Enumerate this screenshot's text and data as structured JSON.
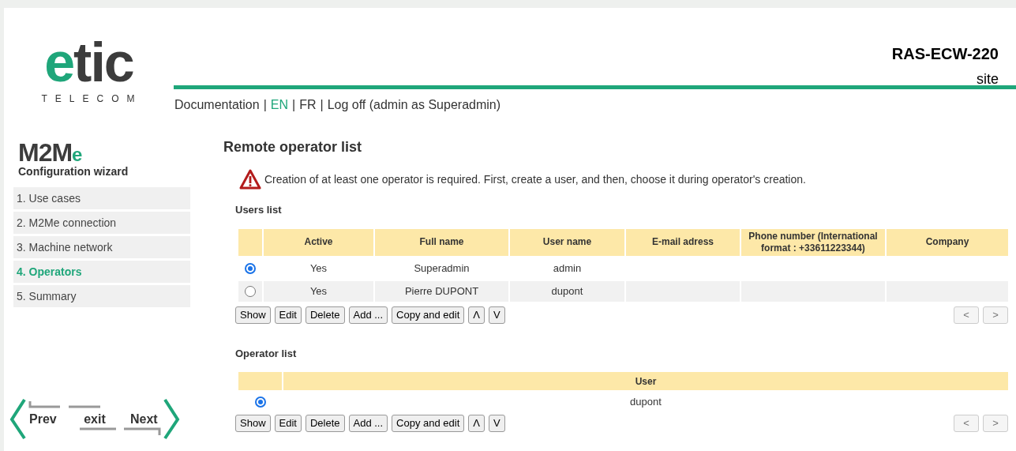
{
  "header": {
    "logo": {
      "main_accent": "e",
      "main": "tic",
      "sub": "TELECOM"
    },
    "device": "RAS-ECW-220",
    "site": "site",
    "links": [
      {
        "kind": "link",
        "label": "Documentation",
        "selected": false
      },
      {
        "kind": "separator",
        "label": "|"
      },
      {
        "kind": "link",
        "label": "EN",
        "selected": true
      },
      {
        "kind": "separator",
        "label": "|"
      },
      {
        "kind": "link",
        "label": "FR",
        "selected": false
      },
      {
        "kind": "separator",
        "label": "|"
      },
      {
        "kind": "link",
        "label": "Log off (admin as Superadmin)",
        "selected": false
      }
    ]
  },
  "sidebar": {
    "brand": {
      "main": "M2M",
      "accent": "e"
    },
    "subtitle": "Configuration wizard",
    "steps": [
      {
        "label": "1. Use cases",
        "selected": false
      },
      {
        "label": "2. M2Me connection",
        "selected": false
      },
      {
        "label": "3. Machine network",
        "selected": false
      },
      {
        "label": "4. Operators",
        "selected": true
      },
      {
        "label": "5. Summary",
        "selected": false
      }
    ],
    "nav": {
      "prev": "Prev",
      "exit": "exit",
      "next": "Next"
    }
  },
  "main": {
    "title": "Remote operator list",
    "warning": "Creation of at least one operator is required. First, create a user, and then, choose it during operator's creation.",
    "users": {
      "title": "Users list",
      "columns": [
        "Active",
        "Full name",
        "User name",
        "E-mail adress",
        "Phone number (International format : +33611223344)",
        "Company"
      ],
      "rows": [
        {
          "selected": true,
          "active": "Yes",
          "full_name": "Superadmin",
          "user_name": "admin"
        },
        {
          "selected": false,
          "active": "Yes",
          "full_name": "Pierre DUPONT",
          "user_name": "dupont"
        }
      ],
      "buttons": [
        "Show",
        "Edit",
        "Delete",
        "Add ...",
        "Copy and edit",
        "Λ",
        "V"
      ],
      "pager": [
        "<",
        ">"
      ]
    },
    "operators": {
      "title": "Operator list",
      "columns": [
        "User"
      ],
      "rows": [
        {
          "selected": true,
          "user": "dupont"
        }
      ],
      "buttons": [
        "Show",
        "Edit",
        "Delete",
        "Add ...",
        "Copy and edit",
        "Λ",
        "V"
      ],
      "pager": [
        "<",
        ">"
      ]
    }
  }
}
